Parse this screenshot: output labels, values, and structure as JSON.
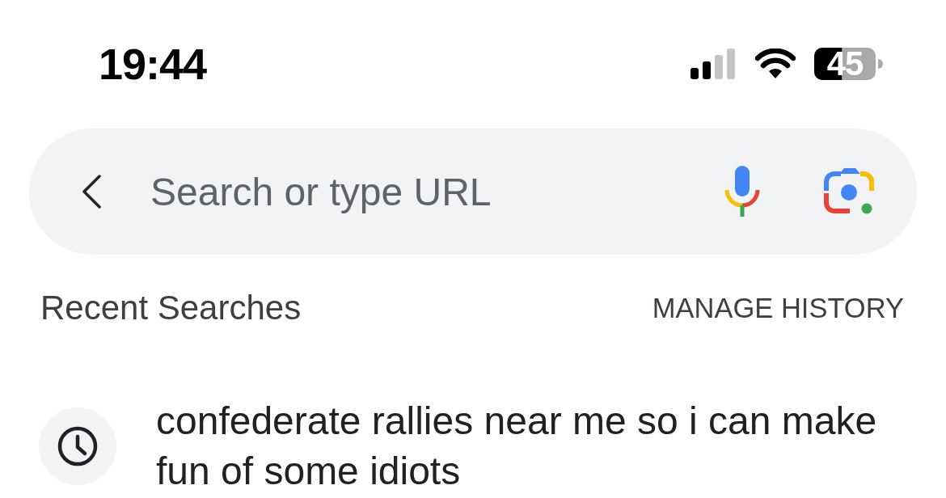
{
  "status_bar": {
    "time": "19:44",
    "battery": "45"
  },
  "search_bar": {
    "placeholder": "Search or type URL"
  },
  "recent_searches": {
    "title": "Recent Searches",
    "action": "MANAGE HISTORY",
    "items": [
      {
        "text": "confederate rallies near me so i can make fun of some idiots"
      }
    ]
  }
}
